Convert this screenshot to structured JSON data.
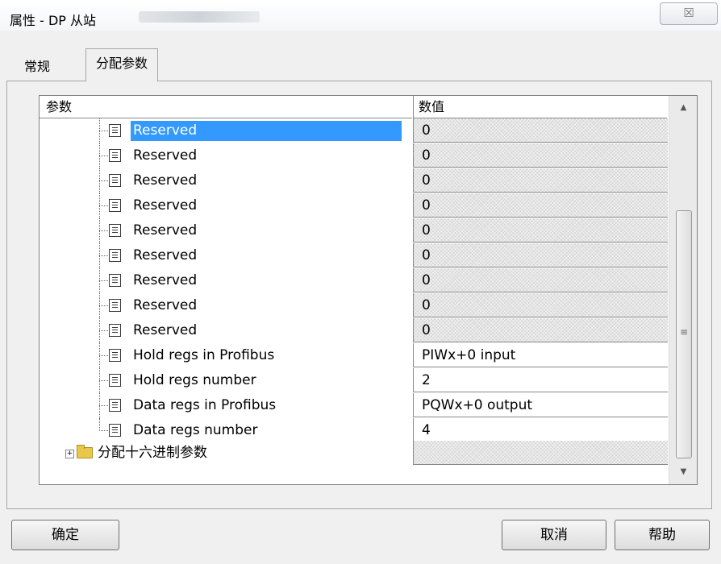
{
  "window": {
    "title": "属性 - DP 从站",
    "close_glyph": "☒"
  },
  "tabs": [
    {
      "label": "常规",
      "active": false
    },
    {
      "label": "分配参数",
      "active": true
    }
  ],
  "grid": {
    "headers": {
      "param": "参数",
      "value": "数值"
    },
    "rows": [
      {
        "label": "Reserved",
        "value": "0",
        "readonly": true,
        "selected": true
      },
      {
        "label": "Reserved",
        "value": "0",
        "readonly": true,
        "selected": false
      },
      {
        "label": "Reserved",
        "value": "0",
        "readonly": true,
        "selected": false
      },
      {
        "label": "Reserved",
        "value": "0",
        "readonly": true,
        "selected": false
      },
      {
        "label": "Reserved",
        "value": "0",
        "readonly": true,
        "selected": false
      },
      {
        "label": "Reserved",
        "value": "0",
        "readonly": true,
        "selected": false
      },
      {
        "label": "Reserved",
        "value": "0",
        "readonly": true,
        "selected": false
      },
      {
        "label": "Reserved",
        "value": "0",
        "readonly": true,
        "selected": false
      },
      {
        "label": "Reserved",
        "value": "0",
        "readonly": true,
        "selected": false
      },
      {
        "label": "Hold regs in Profibus",
        "value": "PIWx+0  input",
        "readonly": false,
        "selected": false
      },
      {
        "label": "Hold regs number",
        "value": "2",
        "readonly": false,
        "selected": false
      },
      {
        "label": "Data regs in Profibus",
        "value": "PQWx+0  output",
        "readonly": false,
        "selected": false
      },
      {
        "label": "Data regs number",
        "value": "4",
        "readonly": false,
        "selected": false
      }
    ],
    "group": {
      "label": "分配十六进制参数",
      "expander": "+",
      "icon": "folder-icon"
    }
  },
  "scrollbar": {
    "up_glyph": "▲",
    "down_glyph": "▼",
    "grip_glyph": "≡"
  },
  "buttons": {
    "ok": "确定",
    "cancel": "取消",
    "help": "帮助"
  },
  "colors": {
    "selection": "#3399ff",
    "readonly_cell": "#d6d6d6"
  }
}
